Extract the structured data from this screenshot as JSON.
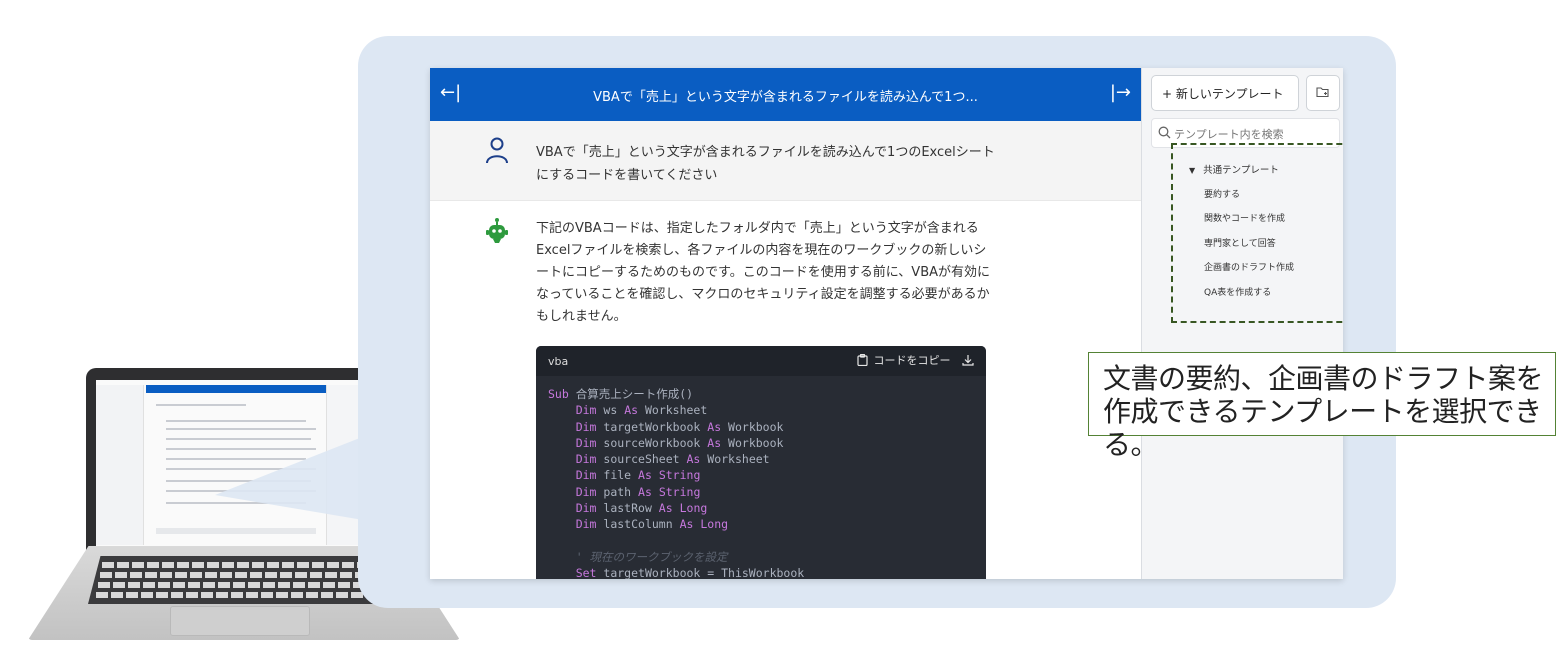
{
  "chat": {
    "title": "VBAで「売上」という文字が含まれるファイルを読み込んで1つ...",
    "collapse_left_icon": "←|",
    "collapse_right_icon": "|→",
    "user_message": "VBAで「売上」という文字が含まれるファイルを読み込んで1つのExcelシートにするコードを書いてください",
    "bot_message": "下記のVBAコードは、指定したフォルダ内で「売上」という文字が含まれるExcelファイルを検索し、各ファイルの内容を現在のワークブックの新しいシートにコピーするためのものです。このコードを使用する前に、VBAが有効になっていることを確認し、マクロのセキュリティ設定を調整する必要があるかもしれません。",
    "code": {
      "language": "vba",
      "copy_label": "コードをコピー",
      "lines": [
        {
          "kw": "Sub",
          "rest": " 合算売上シート作成()"
        },
        {
          "indent": "    ",
          "kw": "Dim",
          "rest": " ws ",
          "kw2": "As",
          "rest2": " Worksheet"
        },
        {
          "indent": "    ",
          "kw": "Dim",
          "rest": " targetWorkbook ",
          "kw2": "As",
          "rest2": " Workbook"
        },
        {
          "indent": "    ",
          "kw": "Dim",
          "rest": " sourceWorkbook ",
          "kw2": "As",
          "rest2": " Workbook"
        },
        {
          "indent": "    ",
          "kw": "Dim",
          "rest": " sourceSheet ",
          "kw2": "As",
          "rest2": " Worksheet"
        },
        {
          "indent": "    ",
          "kw": "Dim",
          "rest": " file ",
          "kw2": "As",
          "rest2": " ",
          "kw3": "String"
        },
        {
          "indent": "    ",
          "kw": "Dim",
          "rest": " path ",
          "kw2": "As",
          "rest2": " ",
          "kw3": "String"
        },
        {
          "indent": "    ",
          "kw": "Dim",
          "rest": " lastRow ",
          "kw2": "As",
          "rest2": " ",
          "kw3": "Long"
        },
        {
          "indent": "    ",
          "kw": "Dim",
          "rest": " lastColumn ",
          "kw2": "As",
          "rest2": " ",
          "kw3": "Long"
        },
        {
          "blank": true
        },
        {
          "indent": "    ",
          "comment": "' 現在のワークブックを設定"
        },
        {
          "indent": "    ",
          "kw": "Set",
          "rest": " targetWorkbook = ThisWorkbook"
        }
      ]
    }
  },
  "templates": {
    "new_button": "+  新しいテンプレート",
    "search_placeholder": "テンプレート内を検索",
    "group": "共通テンプレート",
    "items": [
      "要約する",
      "関数やコードを作成",
      "専門家として回答",
      "企画書のドラフト作成",
      "QA表を作成する"
    ]
  },
  "annotation": {
    "line1": "文書の要約、企画書のドラフト案を",
    "line2": "作成できるテンプレートを選択できる。"
  },
  "colors": {
    "header_blue": "#0a5dc2",
    "panel_bg": "#dde7f3",
    "code_bg": "#282c34",
    "keyword": "#c678dd",
    "highlight_border": "#385723",
    "bot_green": "#2e9a3e"
  },
  "icons": [
    "user-icon",
    "bot-icon",
    "clipboard-icon",
    "download-icon",
    "search-icon",
    "folder-add-icon",
    "caret-down-icon"
  ]
}
